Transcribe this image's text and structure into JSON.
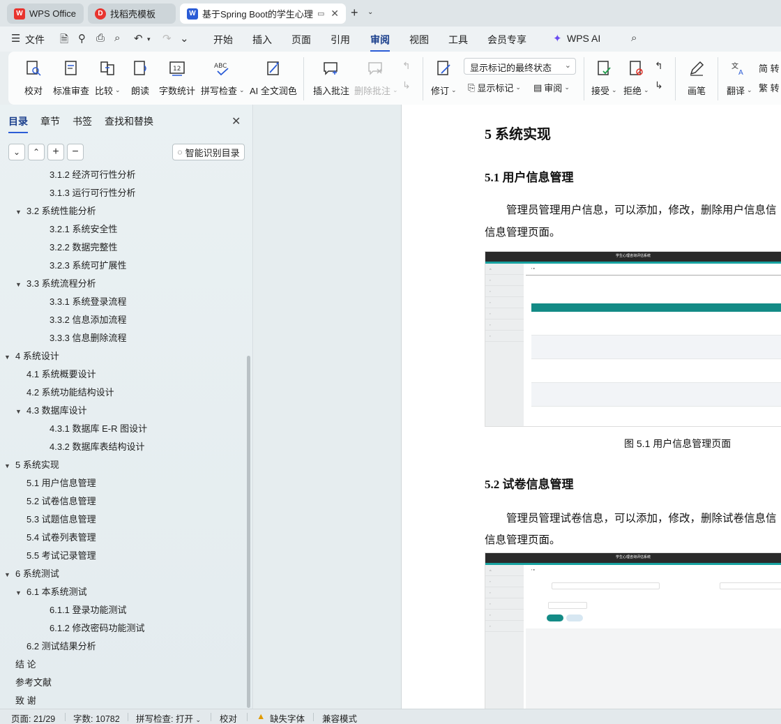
{
  "tabs": [
    {
      "label": "WPS Office",
      "icon": "wps-icon"
    },
    {
      "label": "找稻壳模板",
      "icon": "docer-icon"
    },
    {
      "label": "基于Spring Boot的学生心理",
      "icon": "writer-icon"
    }
  ],
  "menu": {
    "file": "文件",
    "items": [
      "开始",
      "插入",
      "页面",
      "引用",
      "审阅",
      "视图",
      "工具",
      "会员专享"
    ],
    "active": "审阅",
    "wps_ai": "WPS AI"
  },
  "ribbon": {
    "proofread": "校对",
    "standard_review": "标准审查",
    "compare": "比较",
    "read_aloud": "朗读",
    "word_count": "字数统计",
    "spell_check": "拼写检查",
    "ai_polish": "AI 全文润色",
    "insert_comment": "插入批注",
    "delete_comment": "删除批注",
    "track_changes": "修订",
    "display_markup_select": "显示标记的最终状态",
    "show_markup": "显示标记",
    "review": "审阅",
    "accept": "接受",
    "reject": "拒绝",
    "pen": "画笔",
    "translate": "翻译",
    "convert_simplified": "简 转",
    "convert_traditional": "繁 转"
  },
  "navpane": {
    "tabs": [
      "目录",
      "章节",
      "书签",
      "查找和替换"
    ],
    "active_tab": "目录",
    "smart_toc": "智能识别目录",
    "toc": [
      {
        "label": "3.1.2  经济可行性分析",
        "level": 3,
        "arrow": false
      },
      {
        "label": "3.1.3  运行可行性分析",
        "level": 3,
        "arrow": false
      },
      {
        "label": "3.2 系统性能分析",
        "level": 2,
        "arrow": true
      },
      {
        "label": "3.2.1  系统安全性",
        "level": 3,
        "arrow": false
      },
      {
        "label": "3.2.2  数据完整性",
        "level": 3,
        "arrow": false
      },
      {
        "label": "3.2.3 系统可扩展性",
        "level": 3,
        "arrow": false
      },
      {
        "label": "3.3 系统流程分析",
        "level": 2,
        "arrow": true
      },
      {
        "label": "3.3.1 系统登录流程",
        "level": 3,
        "arrow": false
      },
      {
        "label": "3.3.2 信息添加流程",
        "level": 3,
        "arrow": false
      },
      {
        "label": "3.3.3 信息删除流程",
        "level": 3,
        "arrow": false
      },
      {
        "label": "4  系统设计",
        "level": 1,
        "arrow": true
      },
      {
        "label": "4.1 系统概要设计",
        "level": 2,
        "arrow": false
      },
      {
        "label": "4.2 系统功能结构设计",
        "level": 2,
        "arrow": false
      },
      {
        "label": "4.3 数据库设计",
        "level": 2,
        "arrow": true
      },
      {
        "label": "4.3.1 数据库 E-R 图设计",
        "level": 3,
        "arrow": false
      },
      {
        "label": "4.3.2  数据库表结构设计",
        "level": 3,
        "arrow": false
      },
      {
        "label": "5  系统实现",
        "level": 1,
        "arrow": true
      },
      {
        "label": "5.1 用户信息管理",
        "level": 2,
        "arrow": false
      },
      {
        "label": "5.2  试卷信息管理",
        "level": 2,
        "arrow": false
      },
      {
        "label": "5.3  试题信息管理",
        "level": 2,
        "arrow": false
      },
      {
        "label": "5.4 试卷列表管理",
        "level": 2,
        "arrow": false
      },
      {
        "label": "5.5 考试记录管理",
        "level": 2,
        "arrow": false
      },
      {
        "label": "6 系统测试",
        "level": 1,
        "arrow": true
      },
      {
        "label": "6.1  本系统测试",
        "level": 2,
        "arrow": true
      },
      {
        "label": "6.1.1 登录功能测试",
        "level": 3,
        "arrow": false
      },
      {
        "label": "6.1.2 修改密码功能测试",
        "level": 3,
        "arrow": false
      },
      {
        "label": "6.2 测试结果分析",
        "level": 2,
        "arrow": false
      },
      {
        "label": "结    论",
        "level": 1,
        "arrow": false
      },
      {
        "label": "参考文献",
        "level": 1,
        "arrow": false
      },
      {
        "label": "致    谢",
        "level": 1,
        "arrow": false
      }
    ]
  },
  "document": {
    "heading": "5  系统实现",
    "s1_title": "5.1 用户信息管理",
    "s1_para_line1": "管理员管理用户信息，可以添加，修改，删除用户信息信",
    "s1_para_line2": "信息管理页面。",
    "fig1_caption": "图 5.1  用户信息管理页面",
    "s2_title": "5.2  试卷信息管理",
    "s2_para_line1": "管理员管理试卷信息，可以添加，修改，删除试卷信息信",
    "s2_para_line2": "信息管理页面。",
    "shot_title": "学生心理咨询评估系统"
  },
  "statusbar": {
    "page": "页面: 21/29",
    "words": "字数: 10782",
    "spell": "拼写检查: 打开",
    "proof": "校对",
    "missing_font": "缺失字体",
    "compat": "兼容模式"
  }
}
